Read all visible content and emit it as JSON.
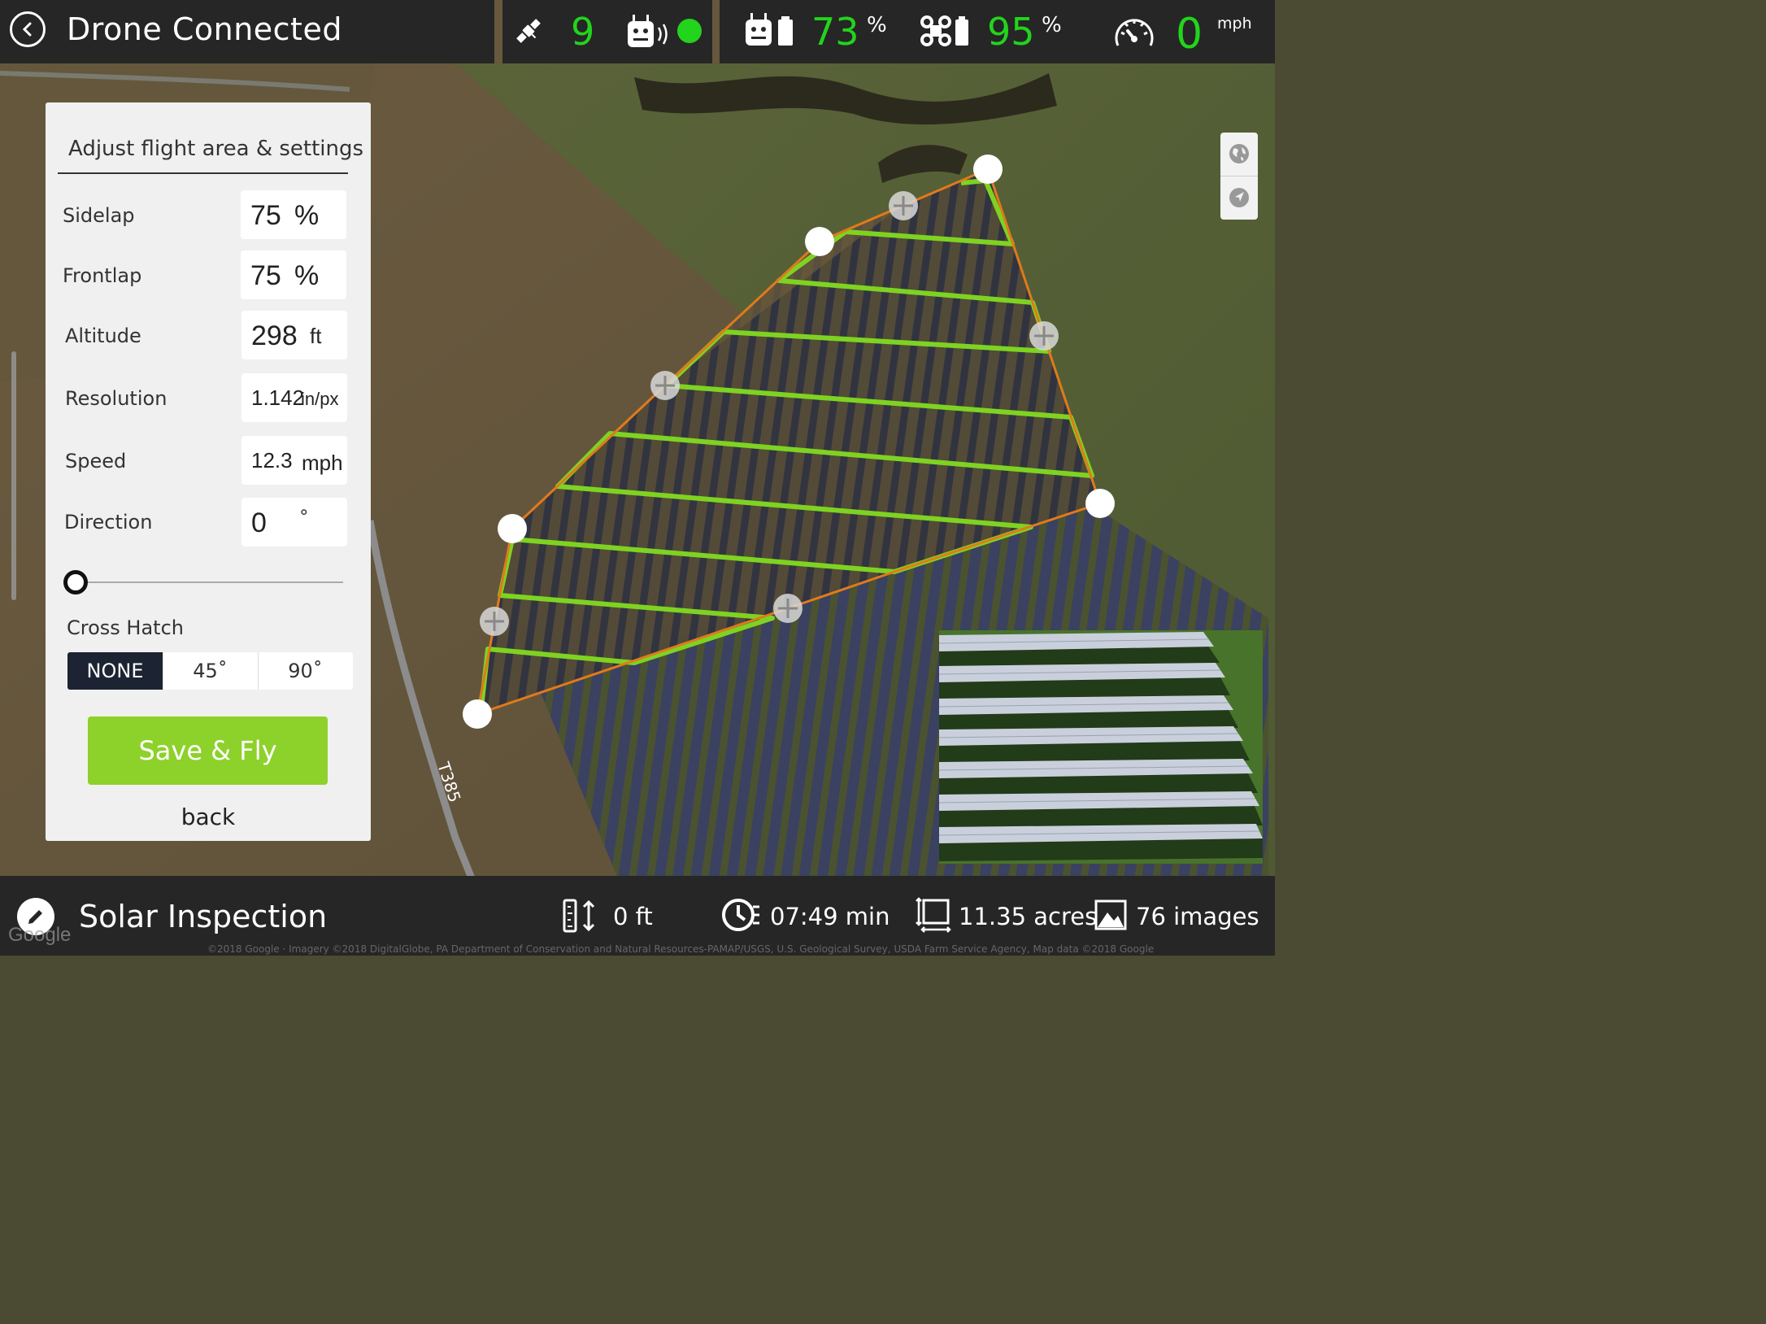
{
  "header": {
    "title": "Drone Connected",
    "satellites": "9",
    "controller_battery": "73",
    "controller_battery_unit": "%",
    "drone_battery": "95",
    "drone_battery_unit": "%",
    "speed": "0",
    "speed_unit": "mph",
    "icons": [
      "back-icon",
      "satellite-icon",
      "remote-signal-icon",
      "connection-dot-icon",
      "remote-battery-icon",
      "drone-battery-icon",
      "speedometer-icon"
    ],
    "colors": {
      "accent": "#22d41c",
      "bar": "#262626"
    }
  },
  "panel": {
    "title": "Adjust flight area & settings",
    "sidelap": {
      "label": "Sidelap",
      "value": "75",
      "unit": "%"
    },
    "frontlap": {
      "label": "Frontlap",
      "value": "75",
      "unit": "%"
    },
    "altitude": {
      "label": "Altitude",
      "value": "298",
      "unit": "ft"
    },
    "resolution": {
      "label": "Resolution",
      "value": "1.142",
      "unit": "in/px"
    },
    "speed": {
      "label": "Speed",
      "value": "12.3",
      "unit": "mph"
    },
    "direction": {
      "label": "Direction",
      "value": "0",
      "unit": "°",
      "slider_value": 0
    },
    "cross_hatch": {
      "label": "Cross Hatch",
      "options": [
        "NONE",
        "45˚",
        "90˚"
      ],
      "selected": "NONE"
    },
    "save_label": "Save & Fly",
    "back_label": "back",
    "colors": {
      "save": "#8dd12b",
      "selected_segment": "#1c2332"
    }
  },
  "map": {
    "road_label": "T385",
    "google_logo": "Google",
    "copyright": "©2018 Google · Imagery ©2018 DigitalGlobe, PA Department of Conservation and Natural Resources-PAMAP/USGS, U.S. Geological Survey, USDA Farm Service Agency, Map data ©2018 Google",
    "controls": [
      "globe-icon",
      "locate-icon"
    ],
    "colors": {
      "boundary": "#e07a1c",
      "flight_path": "#7ed321"
    }
  },
  "footer": {
    "mission_name": "Solar Inspection",
    "elevation": "0 ft",
    "duration": "07:49 min",
    "area": "11.35 acres",
    "images": "76 images",
    "icons": [
      "edit-icon",
      "elevation-icon",
      "timer-icon",
      "area-icon",
      "images-icon"
    ]
  }
}
